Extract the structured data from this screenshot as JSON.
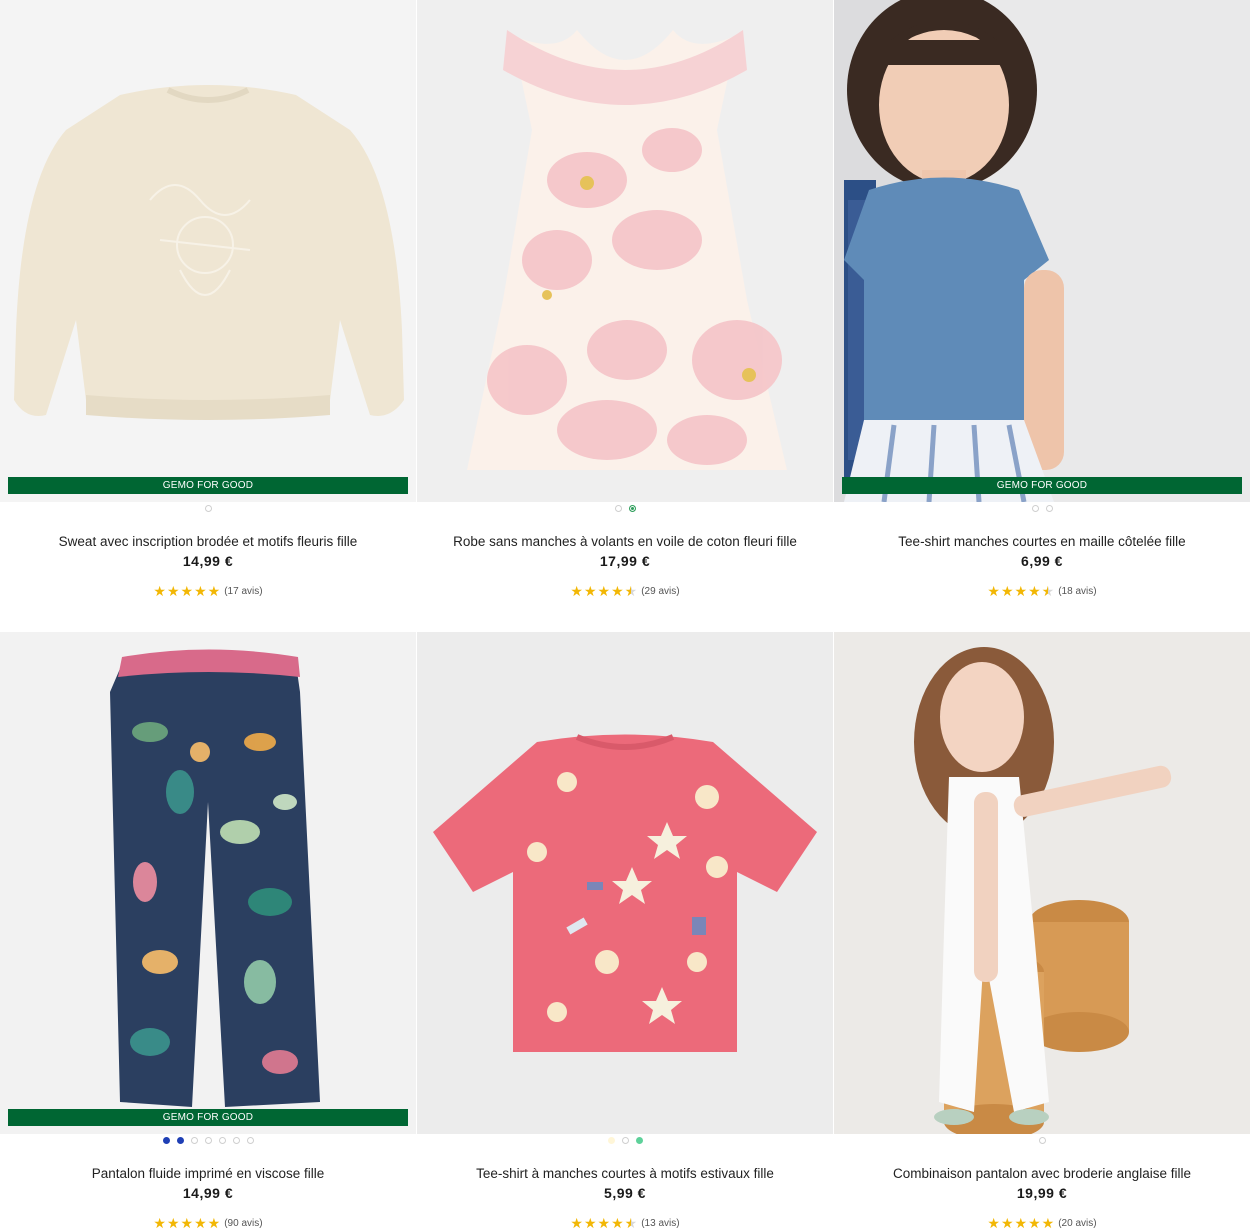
{
  "colors": {
    "badge_bg": "#006633",
    "star": "#f2b705",
    "star_empty": "#d8d8d8"
  },
  "products": [
    {
      "title": "Sweat avec inscription brodée et motifs fleuris fille",
      "price": "14,99 €",
      "rating": 5,
      "reviews": "(17 avis)",
      "badge": "GEMO FOR GOOD",
      "swatches": [
        "#ffffff"
      ],
      "active_swatch": 0,
      "image": "cream-sweatshirt"
    },
    {
      "title": "Robe sans manches à volants en voile de coton fleuri fille",
      "price": "17,99 €",
      "rating": 4.5,
      "reviews": "(29 avis)",
      "badge": "",
      "swatches": [
        "#ffffff",
        "#2e9e5b"
      ],
      "active_swatch": 1,
      "image": "pink-floral-dress"
    },
    {
      "title": "Tee-shirt manches courtes en maille côtelée fille",
      "price": "6,99 €",
      "rating": 4.5,
      "reviews": "(18 avis)",
      "badge": "GEMO FOR GOOD",
      "swatches": [
        "#ffffff",
        "#ffffff"
      ],
      "active_swatch": -1,
      "image": "girl-blue-tshirt"
    },
    {
      "title": "Pantalon fluide imprimé en viscose fille",
      "price": "14,99 €",
      "rating": 5,
      "reviews": "(90 avis)",
      "badge": "GEMO FOR GOOD",
      "swatches": [
        "#1f3fb5",
        "#1f3fb5",
        "#ffffff",
        "#ffffff",
        "#ffffff",
        "#ffffff",
        "#ffffff"
      ],
      "active_swatch": -1,
      "image": "tropical-pants"
    },
    {
      "title": "Tee-shirt à manches courtes à motifs estivaux fille",
      "price": "5,99 €",
      "rating": 4.5,
      "reviews": "(13 avis)",
      "badge": "",
      "swatches": [
        "#fff6d8",
        "#ffffff",
        "#5ed19a"
      ],
      "active_swatch": -1,
      "image": "pink-sea-tshirt"
    },
    {
      "title": "Combinaison pantalon avec broderie anglaise fille",
      "price": "19,99 €",
      "rating": 5,
      "reviews": "(20 avis)",
      "badge": "",
      "swatches": [
        "#ffffff"
      ],
      "active_swatch": -1,
      "image": "girl-white-jumpsuit"
    }
  ]
}
